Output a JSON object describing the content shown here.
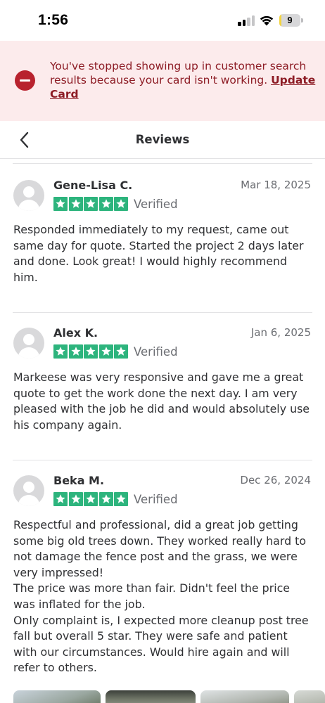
{
  "status_bar": {
    "time": "1:56",
    "battery_level": "9",
    "battery_fraction": 0.09,
    "signal_bars_active": 2,
    "signal_bars_total": 4,
    "battery_color": "#f3d43f"
  },
  "alert": {
    "icon": "minus-circle-icon",
    "message": "You've stopped showing up in customer search results because your card isn't working. ",
    "link_label": "Update Card",
    "background_color": "#fcebec",
    "text_color": "#8d1c25"
  },
  "header": {
    "back_icon": "chevron-left-icon",
    "title": "Reviews"
  },
  "reviews": [
    {
      "name": "Gene-Lisa C.",
      "date": "Mar 18, 2025",
      "rating": 5,
      "verified_label": "Verified",
      "text": "Responded immediately to my request, came out same day for quote. Started the project 2 days later and done. Look great! I would highly recommend him."
    },
    {
      "name": "Alex K.",
      "date": "Jan 6, 2025",
      "rating": 5,
      "verified_label": "Verified",
      "text": "Markeese was very responsive and gave me a great quote to get the work done the next day. I am very pleased with the job he did and would absolutely use his company again."
    },
    {
      "name": "Beka M.",
      "date": "Dec 26, 2024",
      "rating": 5,
      "verified_label": "Verified",
      "text": "Respectful and professional, did a great job getting some big old trees down. They worked really hard to not damage the fence post and the grass, we were very impressed!\nThe price was more than fair. Didn't feel the price was inflated for the job.\nOnly complaint is, I expected more cleanup post tree fall but overall 5 star. They were safe and patient with our circumstances. Would hire again and will refer to others."
    }
  ],
  "star_color": "#2db47d",
  "photo_thumbnails": [
    "photo-thumbnail-1",
    "photo-thumbnail-2",
    "photo-thumbnail-3",
    "photo-thumbnail-4"
  ]
}
